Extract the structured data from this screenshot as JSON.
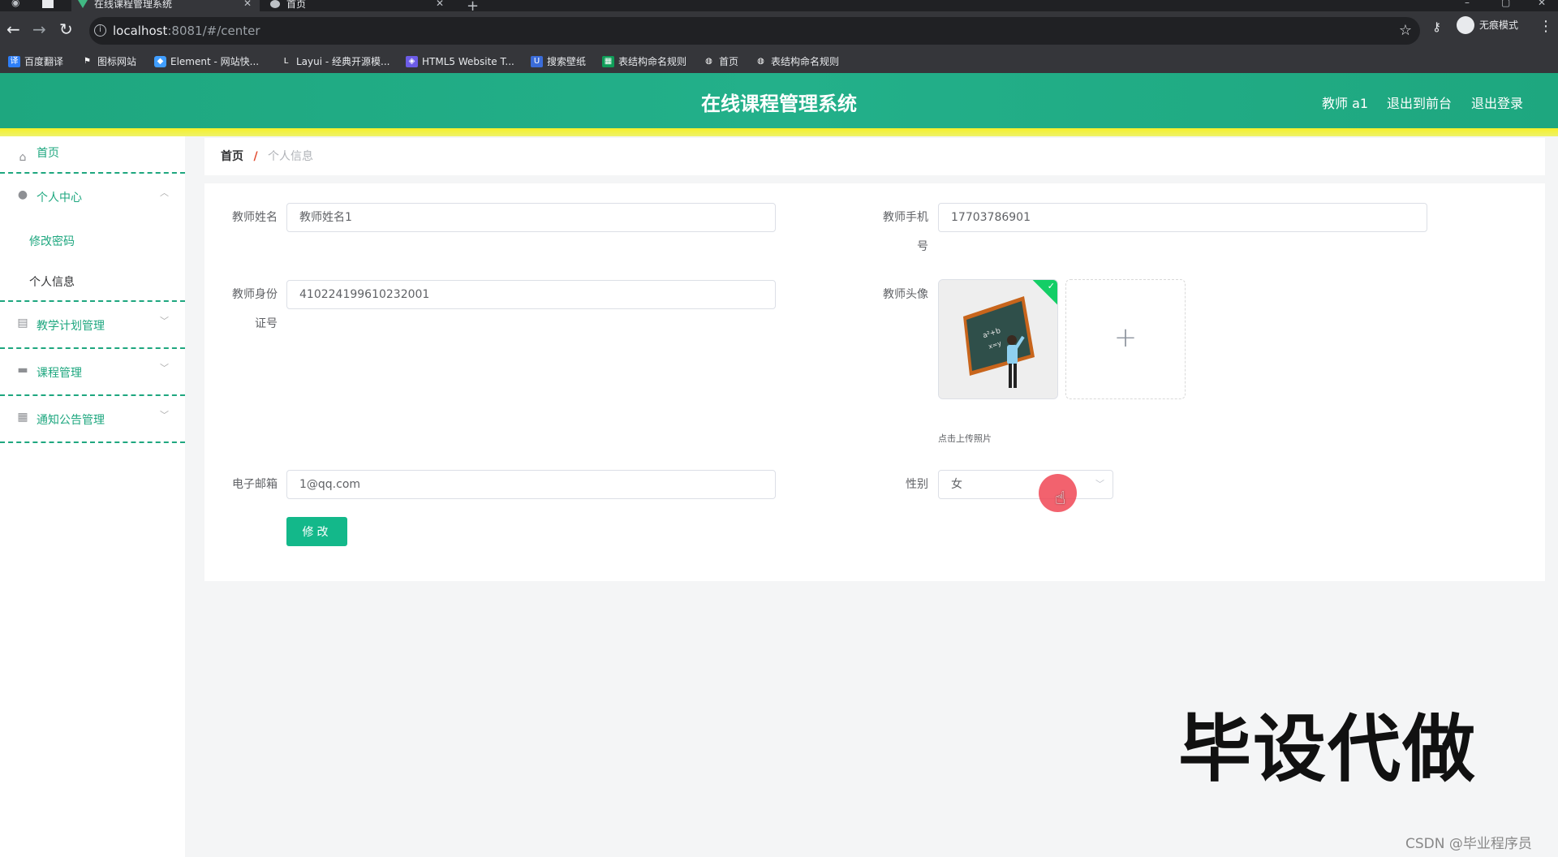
{
  "browser": {
    "tabs": [
      {
        "title": "在线课程管理系统",
        "active": true
      },
      {
        "title": "首页",
        "active": false
      }
    ],
    "new_tab_symbol": "+",
    "url_host": "localhost",
    "url_rest": ":8081/#/center",
    "incognito_label": "无痕模式",
    "bookmarks": [
      "百度翻译",
      "图标网站",
      "Element - 网站快...",
      "Layui - 经典开源模...",
      "HTML5 Website T...",
      "搜索壁纸",
      "表结构命名规则",
      "首页",
      "表结构命名规则"
    ]
  },
  "header": {
    "title": "在线课程管理系统",
    "user": "教师 a1",
    "back_to_front": "退出到前台",
    "logout": "退出登录"
  },
  "sidebar": {
    "items": [
      {
        "label": "首页",
        "icon": "home-icon"
      },
      {
        "label": "个人中心",
        "icon": "user-icon",
        "expanded": true,
        "children": [
          "修改密码",
          "个人信息"
        ]
      },
      {
        "label": "教学计划管理",
        "icon": "clipboard-icon"
      },
      {
        "label": "课程管理",
        "icon": "ticket-icon"
      },
      {
        "label": "通知公告管理",
        "icon": "grid-icon"
      }
    ]
  },
  "breadcrumb": {
    "home": "首页",
    "separator": "/",
    "current": "个人信息"
  },
  "form": {
    "name_label": "教师姓名",
    "name_value": "教师姓名1",
    "phone_label_1": "教师手机",
    "phone_label_2": "号",
    "phone_value": "17703786901",
    "id_label_1": "教师身份",
    "id_label_2": "证号",
    "id_value": "410224199610232001",
    "avatar_label": "教师头像",
    "upload_plus": "+",
    "upload_tip": "点击上传照片",
    "email_label": "电子邮箱",
    "email_value": "1@qq.com",
    "gender_label": "性别",
    "gender_value": "女",
    "submit_label": "修改"
  },
  "overlay": {
    "watermark": "毕设代做",
    "csdn": "CSDN @毕业程序员"
  },
  "colors": {
    "primary": "#1ea77f",
    "accent_bar": "#f5f02a",
    "button": "#13b88a"
  }
}
